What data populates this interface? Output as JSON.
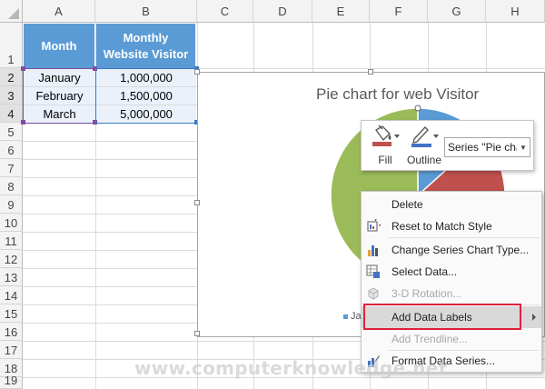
{
  "sheet": {
    "columns": [
      "A",
      "B",
      "C",
      "D",
      "E",
      "F",
      "G",
      "H"
    ],
    "rows": [
      "1",
      "2",
      "3",
      "4",
      "5",
      "6",
      "7",
      "8",
      "9",
      "10",
      "11",
      "12",
      "13",
      "14",
      "15",
      "16",
      "17",
      "18",
      "19"
    ],
    "header": {
      "month": "Month",
      "visitor_line1": "Monthly",
      "visitor_line2": "Website Visitor"
    },
    "data": [
      {
        "month": "January",
        "value": "1,000,000"
      },
      {
        "month": "February",
        "value": "1,500,000"
      },
      {
        "month": "March",
        "value": "5,000,000"
      }
    ]
  },
  "chart": {
    "title": "Pie chart for web Visitor",
    "legend_partial": "Ja",
    "colors": {
      "january": "#5b9bd5",
      "february": "#c0504d",
      "march": "#9bbb59"
    }
  },
  "chart_data": {
    "type": "pie",
    "title": "Pie chart for web Visitor",
    "categories": [
      "January",
      "February",
      "March"
    ],
    "values": [
      1000000,
      1500000,
      5000000
    ],
    "colors": [
      "#5b9bd5",
      "#c0504d",
      "#9bbb59"
    ]
  },
  "minitoolbar": {
    "fill_label": "Fill",
    "outline_label": "Outline",
    "series_value": "Series \"Pie char"
  },
  "context_menu": {
    "items": [
      {
        "label": "Delete",
        "icon": "none",
        "disabled": false
      },
      {
        "label": "Reset to Match Style",
        "icon": "reset-style-icon",
        "disabled": false
      },
      {
        "label": "Change Series Chart Type...",
        "icon": "chart-type-icon",
        "disabled": false
      },
      {
        "label": "Select Data...",
        "icon": "select-data-icon",
        "disabled": false
      },
      {
        "label": "3-D Rotation...",
        "icon": "rotation-3d-icon",
        "disabled": true
      },
      {
        "label": "Add Data Labels",
        "icon": "none",
        "disabled": false,
        "submenu": true
      },
      {
        "label": "Add Trendline...",
        "icon": "none",
        "disabled": true
      },
      {
        "label": "Format Data Series...",
        "icon": "format-series-icon",
        "disabled": false
      }
    ],
    "highlight_color": "#e0203a"
  },
  "watermark": "www.computerknowledge.net"
}
